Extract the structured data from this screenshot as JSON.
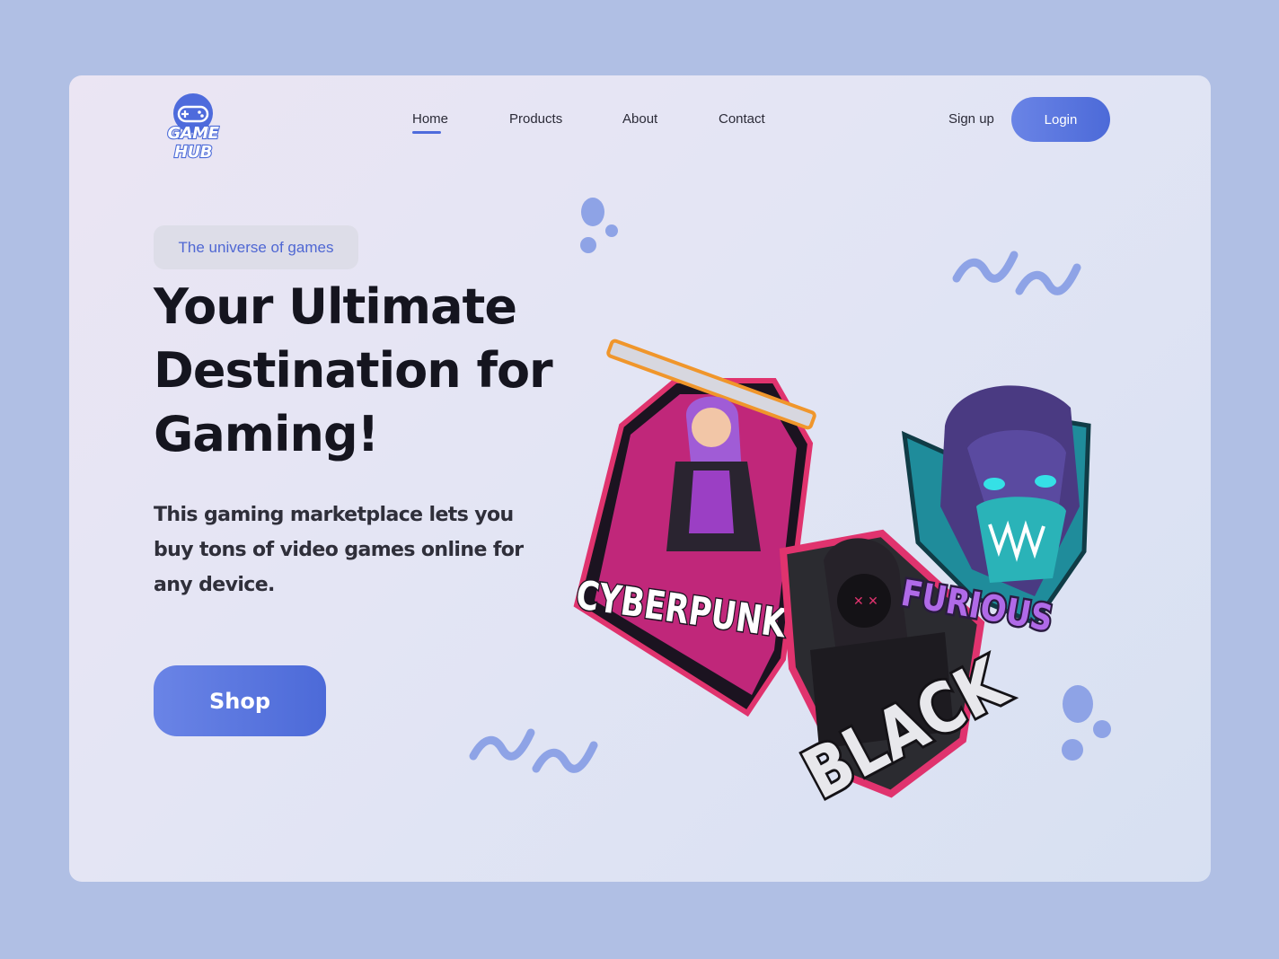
{
  "brand": {
    "logo_text": "GAME HUB"
  },
  "nav": {
    "items": [
      {
        "label": "Home",
        "active": true
      },
      {
        "label": "Products"
      },
      {
        "label": "About"
      },
      {
        "label": "Contact"
      }
    ]
  },
  "auth": {
    "signup_label": "Sign up",
    "login_label": "Login"
  },
  "hero": {
    "tagline": "The universe of games",
    "headline": "Your Ultimate Destination for Gaming!",
    "description": "This gaming marketplace lets you buy tons of video games online for any device.",
    "cta_label": "Shop"
  },
  "illustration": {
    "badges": [
      {
        "label": "CYBERPUNK"
      },
      {
        "label": "BLACK"
      },
      {
        "label": "FURIOUS"
      }
    ]
  },
  "colors": {
    "accent": "#4e6bdc",
    "background": "#b0bfe4",
    "decoration": "#8ea3e6"
  }
}
